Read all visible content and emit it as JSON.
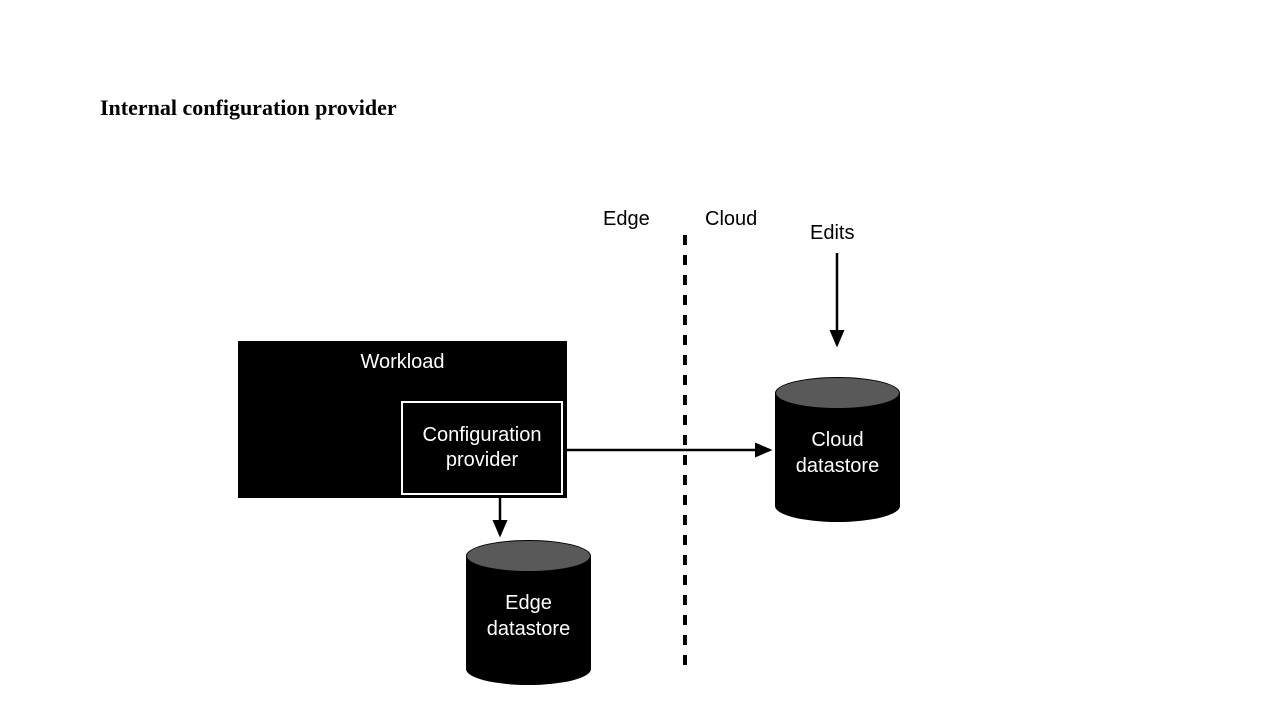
{
  "title": "Internal configuration provider",
  "labels": {
    "edge": "Edge",
    "cloud": "Cloud",
    "edits": "Edits"
  },
  "nodes": {
    "workload": "Workload",
    "config_provider": "Configuration provider",
    "edge_datastore": "Edge datastore",
    "cloud_datastore": "Cloud datastore"
  },
  "chart_data": {
    "type": "diagram",
    "title": "Internal configuration provider",
    "regions": [
      {
        "name": "Edge",
        "side": "left"
      },
      {
        "name": "Cloud",
        "side": "right"
      }
    ],
    "nodes": [
      {
        "id": "workload",
        "label": "Workload",
        "shape": "rect",
        "region": "Edge"
      },
      {
        "id": "config_provider",
        "label": "Configuration provider",
        "shape": "rect",
        "region": "Edge",
        "parent": "workload"
      },
      {
        "id": "edge_datastore",
        "label": "Edge datastore",
        "shape": "cylinder",
        "region": "Edge"
      },
      {
        "id": "cloud_datastore",
        "label": "Cloud datastore",
        "shape": "cylinder",
        "region": "Cloud"
      },
      {
        "id": "edits",
        "label": "Edits",
        "shape": "text",
        "region": "Cloud"
      }
    ],
    "edges": [
      {
        "from": "config_provider",
        "to": "cloud_datastore"
      },
      {
        "from": "config_provider",
        "to": "edge_datastore"
      },
      {
        "from": "edits",
        "to": "cloud_datastore"
      }
    ]
  }
}
